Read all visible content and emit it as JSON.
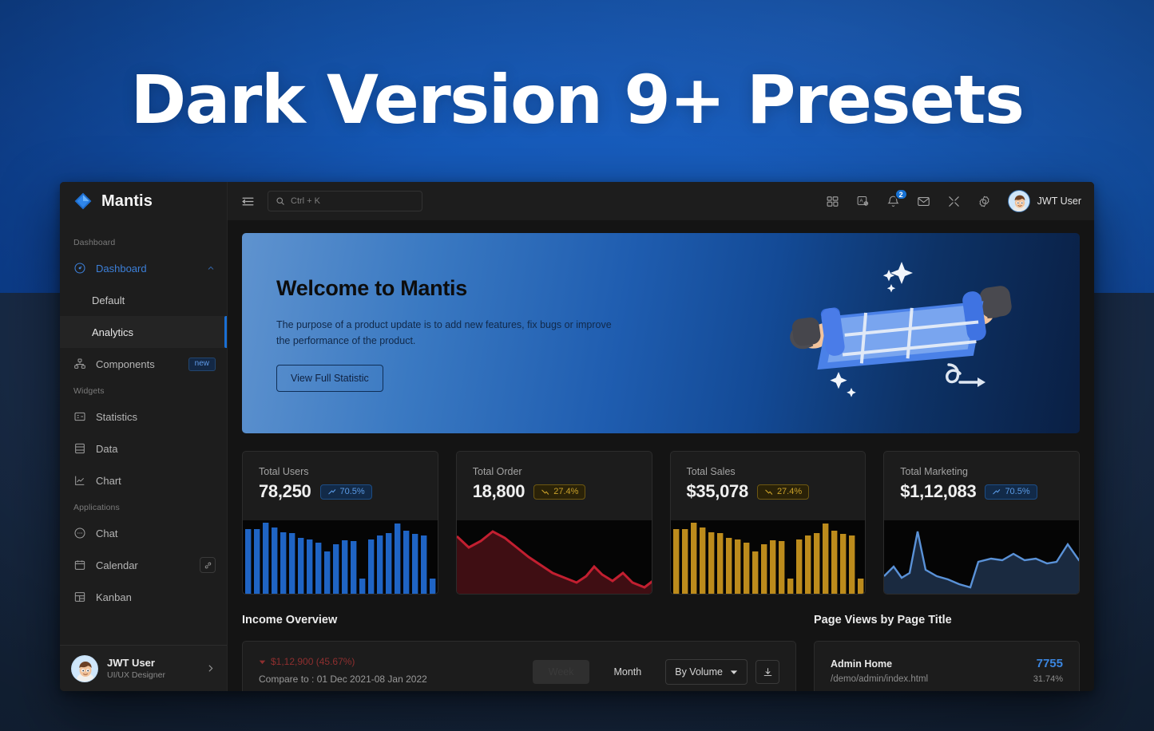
{
  "hero": {
    "title": "Dark Version 9+ Presets"
  },
  "brand": {
    "name": "Mantis",
    "logo_icon": "diamond-logo-icon"
  },
  "sidebar": {
    "sections": [
      {
        "caption": "Dashboard",
        "items": [
          {
            "label": "Dashboard",
            "icon": "dashboard-icon",
            "active": true,
            "expanded": true,
            "children": [
              {
                "label": "Default",
                "selected": false
              },
              {
                "label": "Analytics",
                "selected": true
              }
            ]
          },
          {
            "label": "Components",
            "icon": "components-icon",
            "badge": "new"
          }
        ]
      },
      {
        "caption": "Widgets",
        "items": [
          {
            "label": "Statistics",
            "icon": "statistics-icon"
          },
          {
            "label": "Data",
            "icon": "data-icon"
          },
          {
            "label": "Chart",
            "icon": "chart-icon"
          }
        ]
      },
      {
        "caption": "Applications",
        "items": [
          {
            "label": "Chat",
            "icon": "chat-icon"
          },
          {
            "label": "Calendar",
            "icon": "calendar-icon",
            "badge_icon": "link-icon"
          },
          {
            "label": "Kanban",
            "icon": "kanban-icon"
          }
        ]
      }
    ],
    "user_card": {
      "name": "JWT User",
      "role": "UI/UX Designer",
      "avatar_icon": "avatar",
      "chevron_icon": "chevron-right-icon"
    }
  },
  "topbar": {
    "menu_icon": "menu-toggle-icon",
    "search": {
      "placeholder": "Ctrl + K",
      "icon": "search-icon"
    },
    "icons": [
      {
        "name": "apps-grid-icon"
      },
      {
        "name": "translate-icon"
      },
      {
        "name": "bell-icon",
        "badge": "2"
      },
      {
        "name": "mail-icon"
      },
      {
        "name": "fullscreen-icon"
      },
      {
        "name": "gear-icon"
      }
    ],
    "profile": {
      "name": "JWT User",
      "avatar_icon": "avatar"
    }
  },
  "welcome": {
    "heading": "Welcome to Mantis",
    "body": "The purpose of a product update is to add new features, fix bugs or improve the performance of the product.",
    "cta": "View Full Statistic",
    "illustration_icon": "hands-holding-blueprint-illustration"
  },
  "stats": [
    {
      "label": "Total Users",
      "value": "78,250",
      "delta": "70.5%",
      "direction": "up",
      "trend_icon": "trend-up-icon",
      "accent": "#1f64c4",
      "type": "bar"
    },
    {
      "label": "Total Order",
      "value": "18,800",
      "delta": "27.4%",
      "direction": "down",
      "trend_icon": "trend-down-icon",
      "accent": "#b52230",
      "type": "area"
    },
    {
      "label": "Total Sales",
      "value": "$35,078",
      "delta": "27.4%",
      "direction": "down",
      "trend_icon": "trend-down-icon",
      "accent": "#bc8b1c",
      "type": "bar"
    },
    {
      "label": "Total Marketing",
      "value": "$1,12,083",
      "delta": "70.5%",
      "direction": "up",
      "trend_icon": "trend-up-icon",
      "accent": "#4b82c9",
      "type": "area"
    }
  ],
  "income": {
    "title": "Income Overview",
    "delta": "$1,12,900 (45.67%)",
    "delta_icon": "caret-down-icon",
    "compare": "Compare to : 01 Dec 2021-08 Jan 2022",
    "range_buttons": [
      {
        "label": "Week",
        "selected": true
      },
      {
        "label": "Month",
        "selected": false
      }
    ],
    "metric_select": {
      "value": "By Volume",
      "caret_icon": "caret-down-icon"
    },
    "download_icon": "download-icon"
  },
  "page_views": {
    "title": "Page Views by Page Title",
    "rows": [
      {
        "title": "Admin Home",
        "url": "/demo/admin/index.html",
        "count": "7755",
        "pct": "31.74%"
      }
    ]
  },
  "chart_data": [
    {
      "type": "bar",
      "title": "Total Users",
      "categories": [
        "1",
        "2",
        "3",
        "4",
        "5",
        "6",
        "7",
        "8",
        "9",
        "10",
        "11",
        "12",
        "13",
        "14",
        "15",
        "16",
        "17",
        "18",
        "19",
        "20",
        "21",
        "22",
        "23",
        "24"
      ],
      "values": [
        88,
        88,
        97,
        90,
        84,
        83,
        76,
        74,
        70,
        58,
        68,
        73,
        72,
        20,
        74,
        79,
        82,
        95,
        85,
        81,
        79,
        20,
        84,
        86
      ],
      "series": [
        {
          "name": "Total Users",
          "values": [
            88,
            88,
            97,
            90,
            84,
            83,
            76,
            74,
            70,
            58,
            68,
            73,
            72,
            20,
            74,
            79,
            82,
            95,
            85,
            81,
            79,
            20,
            84,
            86
          ]
        }
      ],
      "color": "#1f64c4",
      "ylim": [
        0,
        100
      ],
      "grid": false,
      "xlabel": "",
      "ylabel": ""
    },
    {
      "type": "area",
      "title": "Total Order",
      "x": [
        0,
        1,
        2,
        3,
        4,
        5,
        6,
        7,
        8,
        9,
        10,
        11,
        12,
        13,
        14,
        15,
        16,
        17,
        18,
        19
      ],
      "values": [
        78,
        62,
        72,
        66,
        55,
        46,
        38,
        28,
        20,
        16,
        22,
        33,
        21,
        28,
        18,
        12,
        16,
        23,
        18,
        20
      ],
      "color": "#b52230",
      "ylim": [
        0,
        100
      ],
      "grid": false,
      "xlabel": "",
      "ylabel": ""
    },
    {
      "type": "bar",
      "title": "Total Sales",
      "categories": [
        "1",
        "2",
        "3",
        "4",
        "5",
        "6",
        "7",
        "8",
        "9",
        "10",
        "11",
        "12",
        "13",
        "14",
        "15",
        "16",
        "17",
        "18",
        "19",
        "20",
        "21",
        "22",
        "23",
        "24"
      ],
      "values": [
        88,
        88,
        97,
        90,
        84,
        83,
        76,
        74,
        70,
        58,
        68,
        73,
        72,
        20,
        74,
        79,
        82,
        95,
        85,
        81,
        79,
        20,
        84,
        86
      ],
      "color": "#bc8b1c",
      "ylim": [
        0,
        100
      ],
      "grid": false,
      "xlabel": "",
      "ylabel": ""
    },
    {
      "type": "area",
      "title": "Total Marketing",
      "x": [
        0,
        1,
        2,
        3,
        4,
        5,
        6,
        7,
        8,
        9,
        10,
        11,
        12,
        13,
        14,
        15,
        16,
        17,
        18,
        19,
        20
      ],
      "values": [
        22,
        34,
        18,
        24,
        88,
        30,
        22,
        18,
        14,
        10,
        42,
        46,
        44,
        52,
        44,
        46,
        40,
        42,
        64,
        44,
        50
      ],
      "color": "#4b82c9",
      "ylim": [
        0,
        100
      ],
      "grid": false,
      "xlabel": "",
      "ylabel": ""
    }
  ]
}
